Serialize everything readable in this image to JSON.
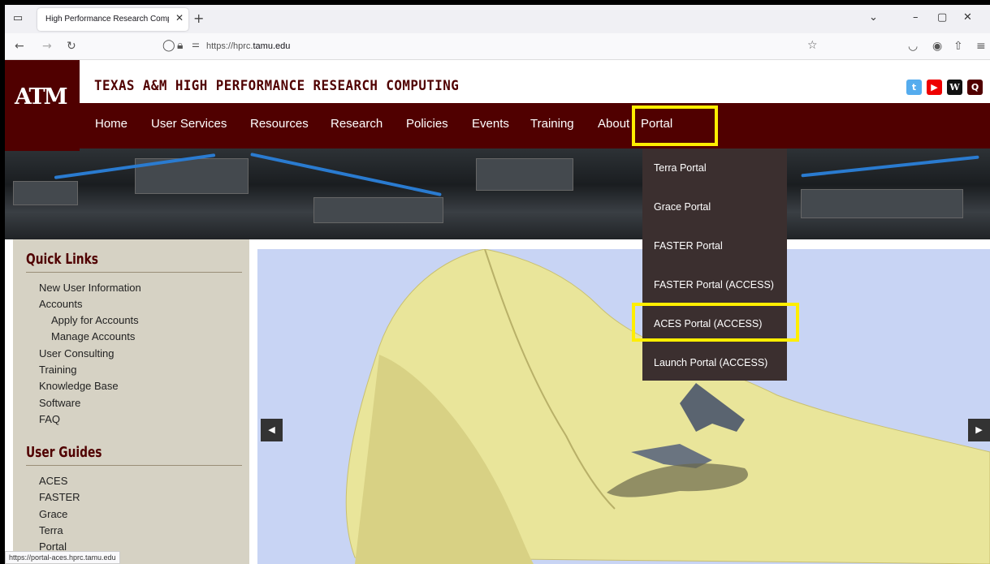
{
  "browser": {
    "tab_title": "High Performance Research Compu",
    "url_prefix": "https://hprc.",
    "url_domain": "tamu.edu",
    "status_url": "https://portal-aces.hprc.tamu.edu"
  },
  "site": {
    "logo_text": "ATM",
    "title": "TEXAS A&M HIGH PERFORMANCE RESEARCH COMPUTING"
  },
  "menu": {
    "items": [
      {
        "label": "Home"
      },
      {
        "label": "User Services"
      },
      {
        "label": "Resources"
      },
      {
        "label": "Research"
      },
      {
        "label": "Policies"
      },
      {
        "label": "Events"
      },
      {
        "label": "Training"
      },
      {
        "label": "About"
      },
      {
        "label": "Portal"
      }
    ]
  },
  "portal_dropdown": {
    "items": [
      {
        "label": "Terra Portal"
      },
      {
        "label": "Grace Portal"
      },
      {
        "label": "FASTER Portal"
      },
      {
        "label": "FASTER Portal (ACCESS)"
      },
      {
        "label": "ACES Portal (ACCESS)"
      },
      {
        "label": "Launch Portal (ACCESS)"
      }
    ]
  },
  "sidebar": {
    "quick_links_heading": "Quick Links",
    "quick_links": [
      {
        "label": "New User Information"
      },
      {
        "label": "Accounts"
      },
      {
        "label": "Apply for Accounts"
      },
      {
        "label": "Manage Accounts"
      },
      {
        "label": "User Consulting"
      },
      {
        "label": "Training"
      },
      {
        "label": "Knowledge Base"
      },
      {
        "label": "Software"
      },
      {
        "label": "FAQ"
      }
    ],
    "user_guides_heading": "User Guides",
    "user_guides": [
      {
        "label": "ACES"
      },
      {
        "label": "FASTER"
      },
      {
        "label": "Grace"
      },
      {
        "label": "Terra"
      },
      {
        "label": "Portal"
      }
    ]
  },
  "colors": {
    "maroon": "#500000",
    "highlight": "#ffee00",
    "dropdown_bg": "#3b2f2f"
  },
  "icons": [
    "tab-list-icon",
    "close-icon",
    "plus-icon",
    "back-icon",
    "forward-icon",
    "reload-icon",
    "shield-icon",
    "lock-icon",
    "permissions-icon",
    "star-icon",
    "pocket-icon",
    "account-icon",
    "extensions-icon",
    "menu-icon",
    "twitter-icon",
    "youtube-icon",
    "wikipedia-icon",
    "search-icon",
    "prev-slide-icon",
    "next-slide-icon"
  ]
}
